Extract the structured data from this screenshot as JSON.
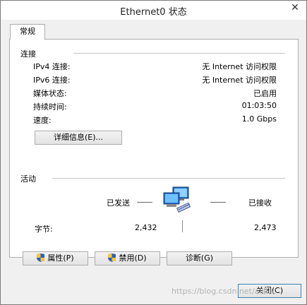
{
  "window": {
    "title": "Ethernet0 状态"
  },
  "tabs": [
    {
      "label": "常规"
    }
  ],
  "connection": {
    "section_title": "连接",
    "rows": [
      {
        "label": "IPv4 连接:",
        "value": "无 Internet 访问权限"
      },
      {
        "label": "IPv6 连接:",
        "value": "无 Internet 访问权限"
      },
      {
        "label": "媒体状态:",
        "value": "已启用"
      },
      {
        "label": "持续时间:",
        "value": "01:03:50"
      },
      {
        "label": "速度:",
        "value": "1.0 Gbps"
      }
    ],
    "details_button": "详细信息(E)..."
  },
  "activity": {
    "section_title": "活动",
    "sent_label": "已发送",
    "received_label": "已接收",
    "bytes_label": "字节:",
    "bytes_sent": "2,432",
    "bytes_received": "2,473"
  },
  "buttons": {
    "properties": "属性(P)",
    "disable": "禁用(D)",
    "diagnose": "诊断(G)",
    "close": "关闭(C)"
  },
  "watermark": "https://blog.csdn.net/ailillic",
  "icons": {
    "close": "close-icon",
    "shield": "shield-icon",
    "network": "network-computers-icon"
  }
}
